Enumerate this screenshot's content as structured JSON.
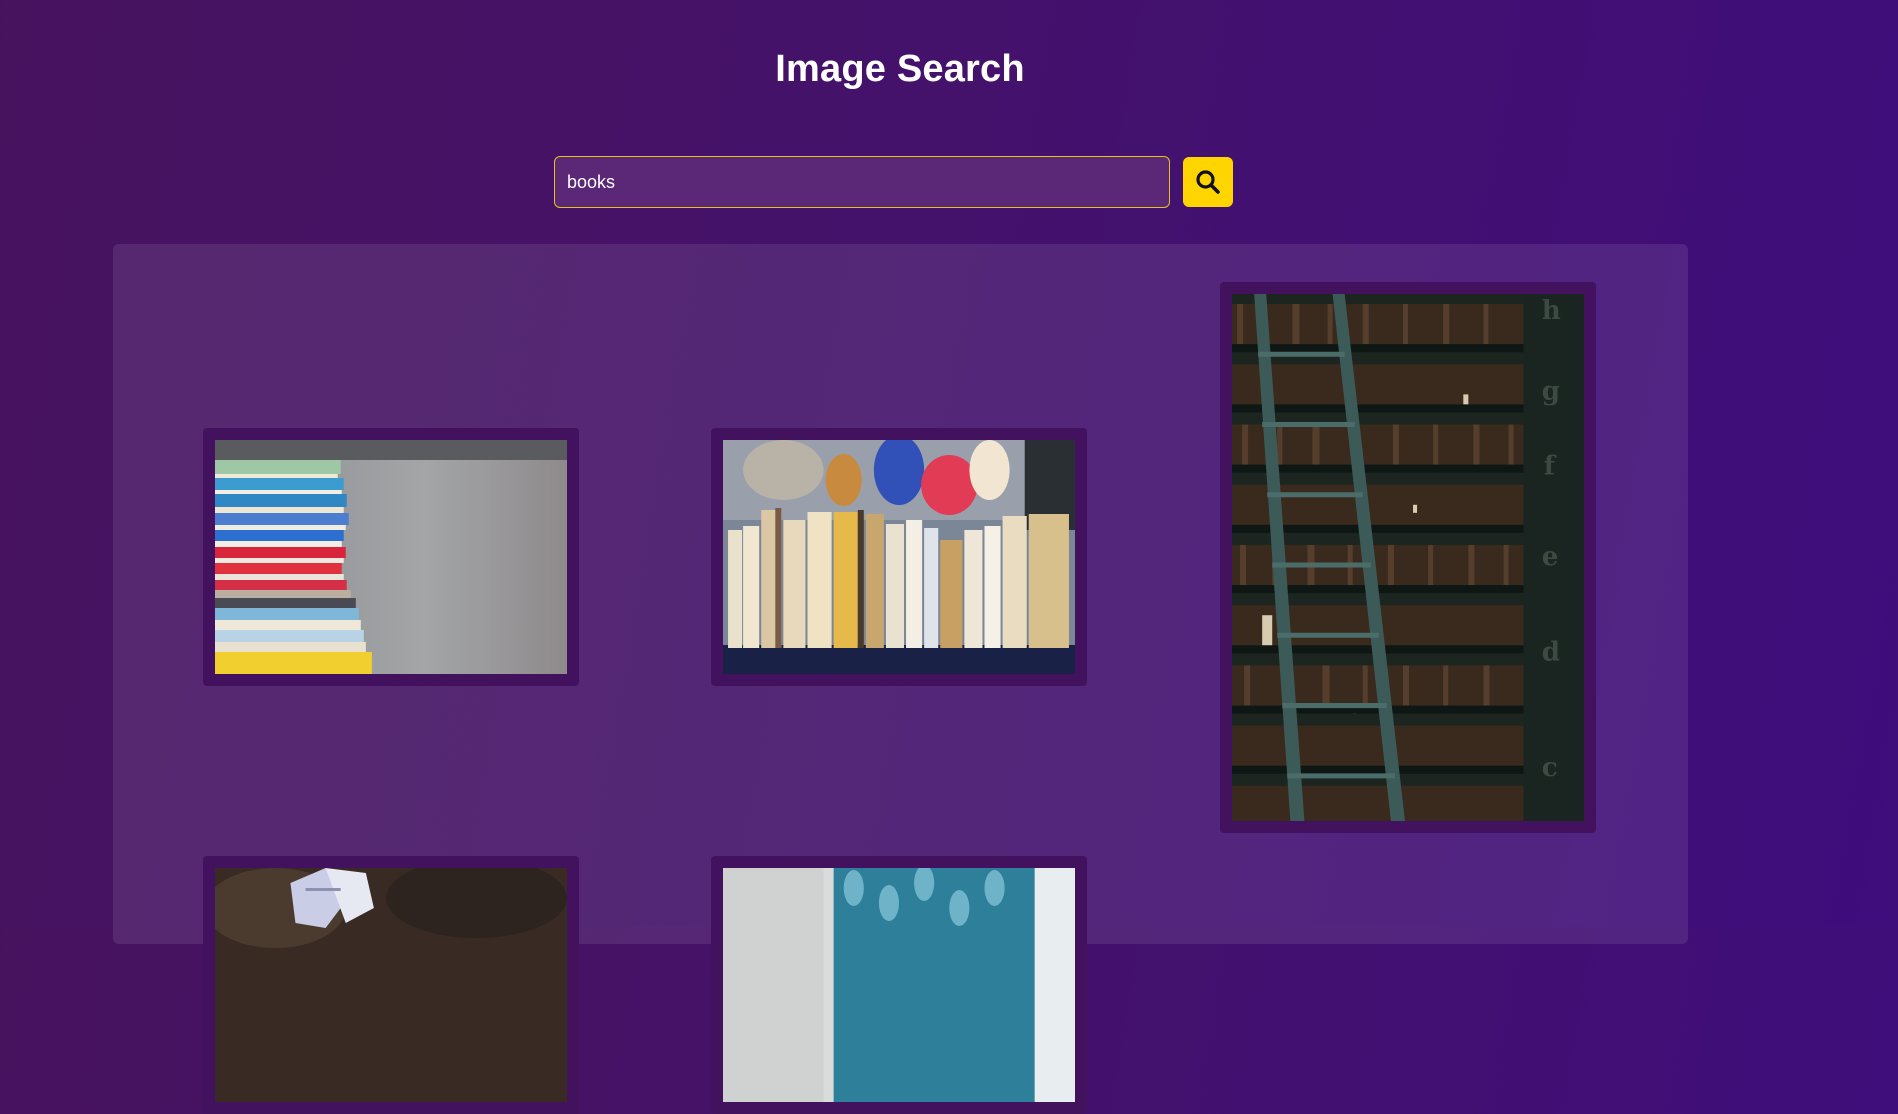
{
  "header": {
    "title": "Image Search"
  },
  "search": {
    "value": "books",
    "button_icon": "search-icon"
  },
  "results": [
    {
      "subject": "stack of colorful books"
    },
    {
      "subject": "row of old books on shelf"
    },
    {
      "subject": "library bookshelves with ladder",
      "shelf_letters": [
        "h",
        "g",
        "f",
        "e",
        "d",
        "c"
      ]
    },
    {
      "subject": "open book on grass"
    },
    {
      "subject": "book near window curtain"
    }
  ],
  "colors": {
    "accent": "#ffd500",
    "background": "#45126a",
    "card": "#42125e"
  }
}
